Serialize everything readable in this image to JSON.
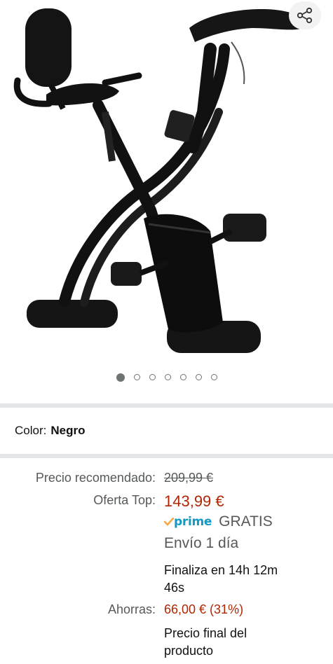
{
  "carousel": {
    "total_images": 7,
    "active_index": 0
  },
  "icons": {
    "share": "share-icon",
    "prime_check": "prime-check-icon"
  },
  "variant": {
    "label": "Color:",
    "value": "Negro"
  },
  "pricing": {
    "list_price_label": "Precio recomendado:",
    "list_price": "209,99 €",
    "deal_label": "Oferta Top:",
    "deal_price": "143,99 €",
    "prime_brand": "prime",
    "shipping_free": "GRATIS",
    "shipping_speed": "Envío 1 día",
    "deal_ends_line1": "Finaliza en 14h 12m",
    "deal_ends_line2": "46s",
    "savings_label": "Ahorras:",
    "savings_value": "66,00 € (31%)",
    "final_price_line1": "Precio final del",
    "final_price_line2": "producto"
  },
  "colors": {
    "price_red": "#b12704",
    "muted_text": "#565959",
    "prime_blue": "#1399c6",
    "prime_check_orange": "#f3a847",
    "divider": "#e3e6e6"
  }
}
